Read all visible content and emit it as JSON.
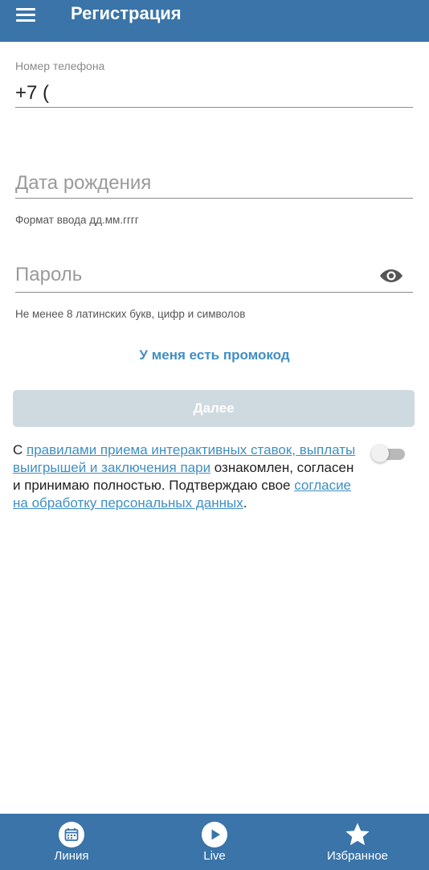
{
  "header": {
    "title": "Регистрация"
  },
  "form": {
    "phone": {
      "label": "Номер телефона",
      "value": "+7 ("
    },
    "birthdate": {
      "placeholder": "Дата рождения",
      "hint": "Формат ввода дд.мм.гггг"
    },
    "password": {
      "placeholder": "Пароль",
      "hint": "Не менее 8 латинских букв, цифр и символов"
    },
    "promo_link": "У меня есть промокод",
    "next_label": "Далее"
  },
  "terms": {
    "prefix": "С ",
    "rules_link": "правилами приема интерактивных ставок, выплаты выигрышей и заключения пари",
    "middle": " ознакомлен, согласен и принимаю полностью. Подтверждаю свое ",
    "consent_link": "согласие на обработку персональных данных",
    "suffix": ".",
    "toggle_on": false
  },
  "bottom_nav": {
    "items": [
      {
        "label": "Линия",
        "icon": "calendar-icon"
      },
      {
        "label": "Live",
        "icon": "play-icon"
      },
      {
        "label": "Избранное",
        "icon": "star-icon"
      }
    ]
  },
  "colors": {
    "primary": "#3a74a8",
    "link": "#3f8fc4",
    "disabled_button": "#cfd9e0"
  }
}
